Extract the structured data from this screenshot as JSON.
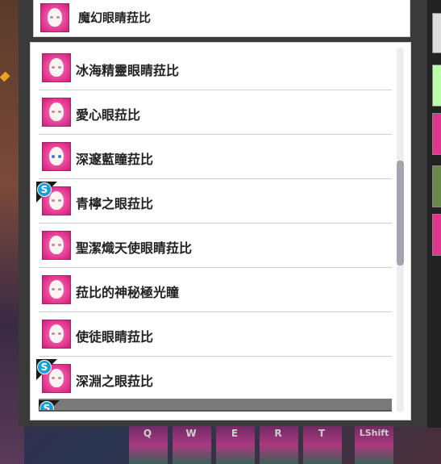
{
  "top_item": {
    "label": "魔幻眼睛菈比",
    "icon": "lapi-face-icon"
  },
  "items": [
    {
      "label": "冰海精靈眼睛菈比",
      "icon": "lapi-face-icon",
      "badge": ""
    },
    {
      "label": "愛心眼菈比",
      "icon": "lapi-face-icon",
      "badge": ""
    },
    {
      "label": "深邃藍瞳菈比",
      "icon": "lapi-face-icon",
      "badge": ""
    },
    {
      "label": "青檸之眼菈比",
      "icon": "lapi-face-icon",
      "badge": "S"
    },
    {
      "label": "聖潔熾天使眼睛菈比",
      "icon": "lapi-face-icon",
      "badge": ""
    },
    {
      "label": "菈比的神秘極光瞳",
      "icon": "lapi-face-icon",
      "badge": ""
    },
    {
      "label": "使徒眼睛菈比",
      "icon": "lapi-face-icon",
      "badge": ""
    },
    {
      "label": "深淵之眼菈比",
      "icon": "lapi-face-icon",
      "badge": "S"
    }
  ],
  "partial_item_badge": "S",
  "hotkeys": [
    "Q",
    "W",
    "E",
    "R",
    "T",
    "LShift"
  ],
  "colors": {
    "icon_bg": "#e2358f",
    "badge": "#19a0d6",
    "panel": "#3a3a3a"
  }
}
